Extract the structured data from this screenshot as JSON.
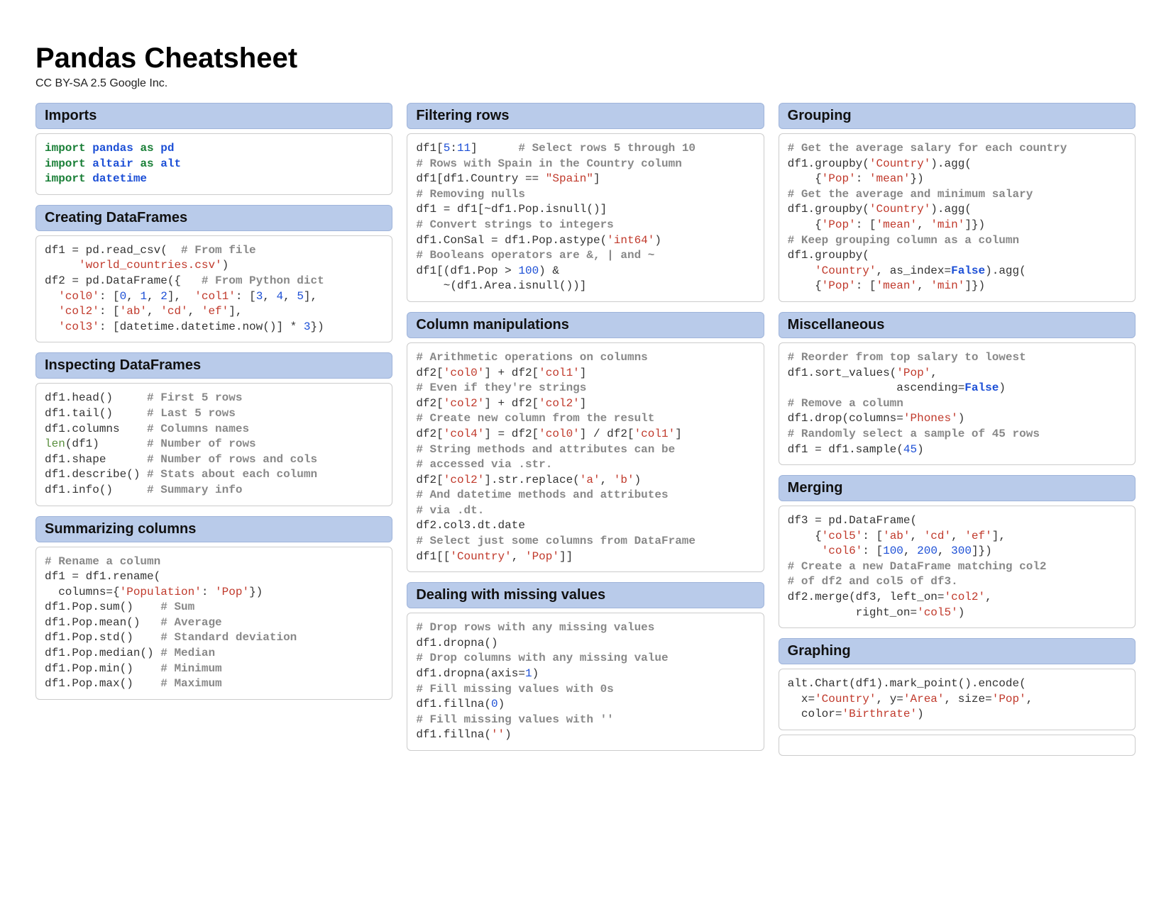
{
  "title": "Pandas Cheatsheet",
  "subtitle": "CC BY-SA 2.5 Google Inc.",
  "col1": {
    "imports": {
      "header": "Imports",
      "lines": [
        [
          [
            "k",
            "import"
          ],
          [
            "t",
            " "
          ],
          [
            "kb",
            "pandas"
          ],
          [
            "t",
            " "
          ],
          [
            "k",
            "as"
          ],
          [
            "t",
            " "
          ],
          [
            "kb",
            "pd"
          ]
        ],
        [
          [
            "k",
            "import"
          ],
          [
            "t",
            " "
          ],
          [
            "kb",
            "altair"
          ],
          [
            "t",
            " "
          ],
          [
            "k",
            "as"
          ],
          [
            "t",
            " "
          ],
          [
            "kb",
            "alt"
          ]
        ],
        [
          [
            "k",
            "import"
          ],
          [
            "t",
            " "
          ],
          [
            "kb",
            "datetime"
          ]
        ]
      ]
    },
    "creating": {
      "header": "Creating DataFrames",
      "lines": [
        [
          [
            "t",
            "df1 = pd.read_csv(  "
          ],
          [
            "c",
            "# From file"
          ]
        ],
        [
          [
            "t",
            "     "
          ],
          [
            "s",
            "'world_countries.csv'"
          ],
          [
            "t",
            ")"
          ]
        ],
        [
          [
            "t",
            "df2 = pd.DataFrame({   "
          ],
          [
            "c",
            "# From Python dict"
          ]
        ],
        [
          [
            "t",
            "  "
          ],
          [
            "s",
            "'col0'"
          ],
          [
            "t",
            ": ["
          ],
          [
            "n",
            "0"
          ],
          [
            "t",
            ", "
          ],
          [
            "n",
            "1"
          ],
          [
            "t",
            ", "
          ],
          [
            "n",
            "2"
          ],
          [
            "t",
            "],  "
          ],
          [
            "s",
            "'col1'"
          ],
          [
            "t",
            ": ["
          ],
          [
            "n",
            "3"
          ],
          [
            "t",
            ", "
          ],
          [
            "n",
            "4"
          ],
          [
            "t",
            ", "
          ],
          [
            "n",
            "5"
          ],
          [
            "t",
            "],"
          ]
        ],
        [
          [
            "t",
            "  "
          ],
          [
            "s",
            "'col2'"
          ],
          [
            "t",
            ": ["
          ],
          [
            "s",
            "'ab'"
          ],
          [
            "t",
            ", "
          ],
          [
            "s",
            "'cd'"
          ],
          [
            "t",
            ", "
          ],
          [
            "s",
            "'ef'"
          ],
          [
            "t",
            "],"
          ]
        ],
        [
          [
            "t",
            "  "
          ],
          [
            "s",
            "'col3'"
          ],
          [
            "t",
            ": [datetime.datetime.now()] * "
          ],
          [
            "n",
            "3"
          ],
          [
            "t",
            "})"
          ]
        ]
      ]
    },
    "inspecting": {
      "header": "Inspecting DataFrames",
      "lines": [
        [
          [
            "t",
            "df1.head()     "
          ],
          [
            "c",
            "# First 5 rows"
          ]
        ],
        [
          [
            "t",
            "df1.tail()     "
          ],
          [
            "c",
            "# Last 5 rows"
          ]
        ],
        [
          [
            "t",
            "df1.columns    "
          ],
          [
            "c",
            "# Columns names"
          ]
        ],
        [
          [
            "bi",
            "len"
          ],
          [
            "t",
            "(df1)       "
          ],
          [
            "c",
            "# Number of rows"
          ]
        ],
        [
          [
            "t",
            "df1.shape      "
          ],
          [
            "c",
            "# Number of rows and cols"
          ]
        ],
        [
          [
            "t",
            "df1.describe() "
          ],
          [
            "c",
            "# Stats about each column"
          ]
        ],
        [
          [
            "t",
            "df1.info()     "
          ],
          [
            "c",
            "# Summary info"
          ]
        ]
      ]
    },
    "summarizing": {
      "header": "Summarizing columns",
      "lines": [
        [
          [
            "c",
            "# Rename a column"
          ]
        ],
        [
          [
            "t",
            "df1 = df1.rename("
          ]
        ],
        [
          [
            "t",
            "  columns={"
          ],
          [
            "s",
            "'Population'"
          ],
          [
            "t",
            ": "
          ],
          [
            "s",
            "'Pop'"
          ],
          [
            "t",
            "})"
          ]
        ],
        [
          [
            "t",
            "df1.Pop.sum()    "
          ],
          [
            "c",
            "# Sum"
          ]
        ],
        [
          [
            "t",
            "df1.Pop.mean()   "
          ],
          [
            "c",
            "# Average"
          ]
        ],
        [
          [
            "t",
            "df1.Pop.std()    "
          ],
          [
            "c",
            "# Standard deviation"
          ]
        ],
        [
          [
            "t",
            "df1.Pop.median() "
          ],
          [
            "c",
            "# Median"
          ]
        ],
        [
          [
            "t",
            "df1.Pop.min()    "
          ],
          [
            "c",
            "# Minimum"
          ]
        ],
        [
          [
            "t",
            "df1.Pop.max()    "
          ],
          [
            "c",
            "# Maximum"
          ]
        ]
      ]
    }
  },
  "col2": {
    "filtering": {
      "header": "Filtering rows",
      "lines": [
        [
          [
            "t",
            "df1["
          ],
          [
            "n",
            "5"
          ],
          [
            "t",
            ":"
          ],
          [
            "n",
            "11"
          ],
          [
            "t",
            "]      "
          ],
          [
            "c",
            "# Select rows 5 through 10"
          ]
        ],
        [
          [
            "c",
            "# Rows with Spain in the Country column"
          ]
        ],
        [
          [
            "t",
            "df1[df1.Country == "
          ],
          [
            "s",
            "\"Spain\""
          ],
          [
            "t",
            "]"
          ]
        ],
        [
          [
            "c",
            "# Removing nulls"
          ]
        ],
        [
          [
            "t",
            "df1 = df1[~df1.Pop.isnull()]"
          ]
        ],
        [
          [
            "c",
            "# Convert strings to integers"
          ]
        ],
        [
          [
            "t",
            "df1.ConSal = df1.Pop.astype("
          ],
          [
            "s",
            "'int64'"
          ],
          [
            "t",
            ")"
          ]
        ],
        [
          [
            "c",
            "# Booleans operators are &, | and ~"
          ]
        ],
        [
          [
            "t",
            "df1[(df1.Pop > "
          ],
          [
            "n",
            "100"
          ],
          [
            "t",
            ") &"
          ]
        ],
        [
          [
            "t",
            "    ~(df1.Area.isnull())]"
          ]
        ]
      ]
    },
    "colmanip": {
      "header": "Column manipulations",
      "lines": [
        [
          [
            "c",
            "# Arithmetic operations on columns"
          ]
        ],
        [
          [
            "t",
            "df2["
          ],
          [
            "s",
            "'col0'"
          ],
          [
            "t",
            "] + df2["
          ],
          [
            "s",
            "'col1'"
          ],
          [
            "t",
            "]"
          ]
        ],
        [
          [
            "c",
            "# Even if they're strings"
          ]
        ],
        [
          [
            "t",
            "df2["
          ],
          [
            "s",
            "'col2'"
          ],
          [
            "t",
            "] + df2["
          ],
          [
            "s",
            "'col2'"
          ],
          [
            "t",
            "]"
          ]
        ],
        [
          [
            "c",
            "# Create new column from the result"
          ]
        ],
        [
          [
            "t",
            "df2["
          ],
          [
            "s",
            "'col4'"
          ],
          [
            "t",
            "] = df2["
          ],
          [
            "s",
            "'col0'"
          ],
          [
            "t",
            "] / df2["
          ],
          [
            "s",
            "'col1'"
          ],
          [
            "t",
            "]"
          ]
        ],
        [
          [
            "c",
            "# String methods and attributes can be"
          ]
        ],
        [
          [
            "c",
            "# accessed via .str."
          ]
        ],
        [
          [
            "t",
            "df2["
          ],
          [
            "s",
            "'col2'"
          ],
          [
            "t",
            "].str.replace("
          ],
          [
            "s",
            "'a'"
          ],
          [
            "t",
            ", "
          ],
          [
            "s",
            "'b'"
          ],
          [
            "t",
            ")"
          ]
        ],
        [
          [
            "c",
            "# And datetime methods and attributes"
          ]
        ],
        [
          [
            "c",
            "# via .dt."
          ]
        ],
        [
          [
            "t",
            "df2.col3.dt.date"
          ]
        ],
        [
          [
            "c",
            "# Select just some columns from DataFrame"
          ]
        ],
        [
          [
            "t",
            "df1[["
          ],
          [
            "s",
            "'Country'"
          ],
          [
            "t",
            ", "
          ],
          [
            "s",
            "'Pop'"
          ],
          [
            "t",
            "]]"
          ]
        ]
      ]
    },
    "missing": {
      "header": "Dealing with missing values",
      "lines": [
        [
          [
            "c",
            "# Drop rows with any missing values"
          ]
        ],
        [
          [
            "t",
            "df1.dropna()"
          ]
        ],
        [
          [
            "c",
            "# Drop columns with any missing value"
          ]
        ],
        [
          [
            "t",
            "df1.dropna(axis="
          ],
          [
            "n",
            "1"
          ],
          [
            "t",
            ")"
          ]
        ],
        [
          [
            "c",
            "# Fill missing values with 0s"
          ]
        ],
        [
          [
            "t",
            "df1.fillna("
          ],
          [
            "n",
            "0"
          ],
          [
            "t",
            ")"
          ]
        ],
        [
          [
            "c",
            "# Fill missing values with ''"
          ]
        ],
        [
          [
            "t",
            "df1.fillna("
          ],
          [
            "s",
            "''"
          ],
          [
            "t",
            ")"
          ]
        ]
      ]
    }
  },
  "col3": {
    "grouping": {
      "header": "Grouping",
      "lines": [
        [
          [
            "c",
            "# Get the average salary for each country"
          ]
        ],
        [
          [
            "t",
            "df1.groupby("
          ],
          [
            "s",
            "'Country'"
          ],
          [
            "t",
            ").agg("
          ]
        ],
        [
          [
            "t",
            "    {"
          ],
          [
            "s",
            "'Pop'"
          ],
          [
            "t",
            ": "
          ],
          [
            "s",
            "'mean'"
          ],
          [
            "t",
            "})"
          ]
        ],
        [
          [
            "c",
            "# Get the average and minimum salary"
          ]
        ],
        [
          [
            "t",
            "df1.groupby("
          ],
          [
            "s",
            "'Country'"
          ],
          [
            "t",
            ").agg("
          ]
        ],
        [
          [
            "t",
            "    {"
          ],
          [
            "s",
            "'Pop'"
          ],
          [
            "t",
            ": ["
          ],
          [
            "s",
            "'mean'"
          ],
          [
            "t",
            ", "
          ],
          [
            "s",
            "'min'"
          ],
          [
            "t",
            "]})"
          ]
        ],
        [
          [
            "c",
            "# Keep grouping column as a column"
          ]
        ],
        [
          [
            "t",
            "df1.groupby("
          ]
        ],
        [
          [
            "t",
            "    "
          ],
          [
            "s",
            "'Country'"
          ],
          [
            "t",
            ", as_index="
          ],
          [
            "kw2",
            "False"
          ],
          [
            "t",
            ").agg("
          ]
        ],
        [
          [
            "t",
            "    {"
          ],
          [
            "s",
            "'Pop'"
          ],
          [
            "t",
            ": ["
          ],
          [
            "s",
            "'mean'"
          ],
          [
            "t",
            ", "
          ],
          [
            "s",
            "'min'"
          ],
          [
            "t",
            "]})"
          ]
        ]
      ]
    },
    "misc": {
      "header": "Miscellaneous",
      "lines": [
        [
          [
            "c",
            "# Reorder from top salary to lowest"
          ]
        ],
        [
          [
            "t",
            "df1.sort_values("
          ],
          [
            "s",
            "'Pop'"
          ],
          [
            "t",
            ","
          ]
        ],
        [
          [
            "t",
            "                ascending="
          ],
          [
            "kw2",
            "False"
          ],
          [
            "t",
            ")"
          ]
        ],
        [
          [
            "c",
            "# Remove a column"
          ]
        ],
        [
          [
            "t",
            "df1.drop(columns="
          ],
          [
            "s",
            "'Phones'"
          ],
          [
            "t",
            ")"
          ]
        ],
        [
          [
            "c",
            "# Randomly select a sample of 45 rows"
          ]
        ],
        [
          [
            "t",
            "df1 = df1.sample("
          ],
          [
            "n",
            "45"
          ],
          [
            "t",
            ")"
          ]
        ]
      ]
    },
    "merging": {
      "header": "Merging",
      "lines": [
        [
          [
            "t",
            "df3 = pd.DataFrame("
          ]
        ],
        [
          [
            "t",
            "    {"
          ],
          [
            "s",
            "'col5'"
          ],
          [
            "t",
            ": ["
          ],
          [
            "s",
            "'ab'"
          ],
          [
            "t",
            ", "
          ],
          [
            "s",
            "'cd'"
          ],
          [
            "t",
            ", "
          ],
          [
            "s",
            "'ef'"
          ],
          [
            "t",
            "],"
          ]
        ],
        [
          [
            "t",
            "     "
          ],
          [
            "s",
            "'col6'"
          ],
          [
            "t",
            ": ["
          ],
          [
            "n",
            "100"
          ],
          [
            "t",
            ", "
          ],
          [
            "n",
            "200"
          ],
          [
            "t",
            ", "
          ],
          [
            "n",
            "300"
          ],
          [
            "t",
            "]})"
          ]
        ],
        [
          [
            "c",
            "# Create a new DataFrame matching col2"
          ]
        ],
        [
          [
            "c",
            "# of df2 and col5 of df3."
          ]
        ],
        [
          [
            "t",
            "df2.merge(df3, left_on="
          ],
          [
            "s",
            "'col2'"
          ],
          [
            "t",
            ","
          ]
        ],
        [
          [
            "t",
            "          right_on="
          ],
          [
            "s",
            "'col5'"
          ],
          [
            "t",
            ")"
          ]
        ]
      ]
    },
    "graphing": {
      "header": "Graphing",
      "lines": [
        [
          [
            "t",
            "alt.Chart(df1).mark_point().encode("
          ]
        ],
        [
          [
            "t",
            "  x="
          ],
          [
            "s",
            "'Country'"
          ],
          [
            "t",
            ", y="
          ],
          [
            "s",
            "'Area'"
          ],
          [
            "t",
            ", size="
          ],
          [
            "s",
            "'Pop'"
          ],
          [
            "t",
            ","
          ]
        ],
        [
          [
            "t",
            "  color="
          ],
          [
            "s",
            "'Birthrate'"
          ],
          [
            "t",
            ")"
          ]
        ]
      ]
    }
  }
}
